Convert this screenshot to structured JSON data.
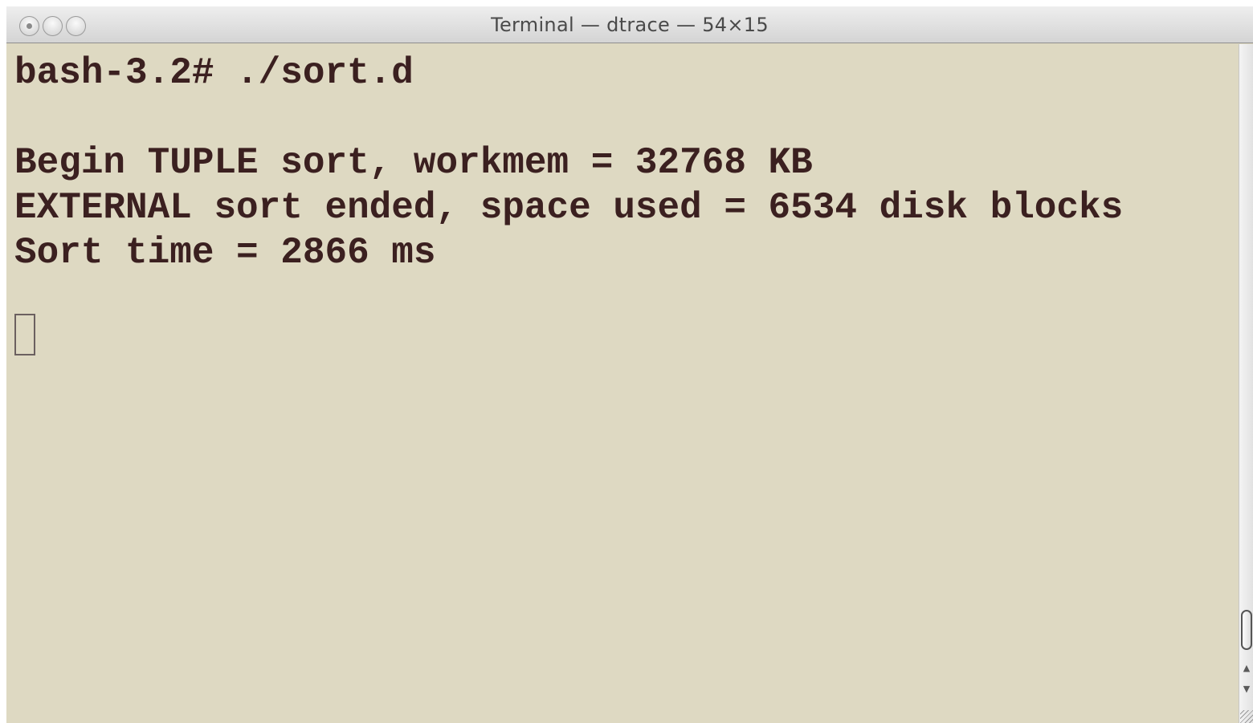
{
  "window": {
    "title": "Terminal — dtrace — 54×15"
  },
  "terminal": {
    "lines": [
      "bash-3.2# ./sort.d",
      "",
      "Begin TUPLE sort, workmem = 32768 KB",
      "EXTERNAL sort ended, space used = 6534 disk blocks",
      "Sort time = 2866 ms"
    ]
  },
  "scrollbar": {
    "up_arrow_icon": "▲",
    "down_arrow_icon": "▼"
  },
  "colors": {
    "background": "#ded9c2",
    "text": "#3b2020"
  }
}
